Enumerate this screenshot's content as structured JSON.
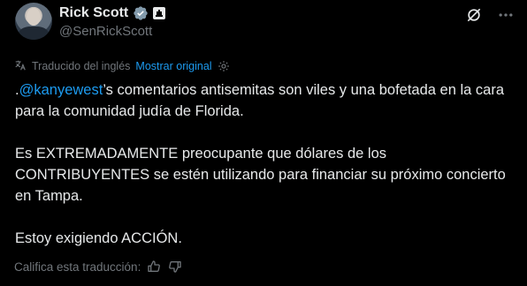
{
  "author": {
    "display_name": "Rick Scott",
    "handle": "@SenRickScott",
    "verified_icon": "verified-check-icon",
    "affiliation_icon": "government-badge-icon"
  },
  "header_actions": {
    "grok_icon": "grok-icon",
    "more_icon": "more-options-icon"
  },
  "translation": {
    "note": "Traducido del inglés",
    "show_original": "Mostrar original",
    "settings_icon": "gear-icon"
  },
  "tweet": {
    "line1_prefix": ".",
    "mention": "@kanyewest",
    "line1_rest": "’s comentarios antisemitas son viles y una bofetada en la cara para la comunidad judía de Florida.",
    "paragraph2": "Es EXTREMADAMENTE preocupante que dólares de los CONTRIBUYENTES se estén utilizando para financiar su próximo concierto en Tampa.",
    "paragraph3": "Estoy exigiendo ACCIÓN."
  },
  "rating": {
    "label": "Califica esta traducción:",
    "thumbs_up_icon": "thumbs-up-icon",
    "thumbs_down_icon": "thumbs-down-icon"
  },
  "colors": {
    "background": "#000000",
    "text": "#e7e9ea",
    "muted": "#71767b",
    "accent": "#1d9bf0"
  }
}
